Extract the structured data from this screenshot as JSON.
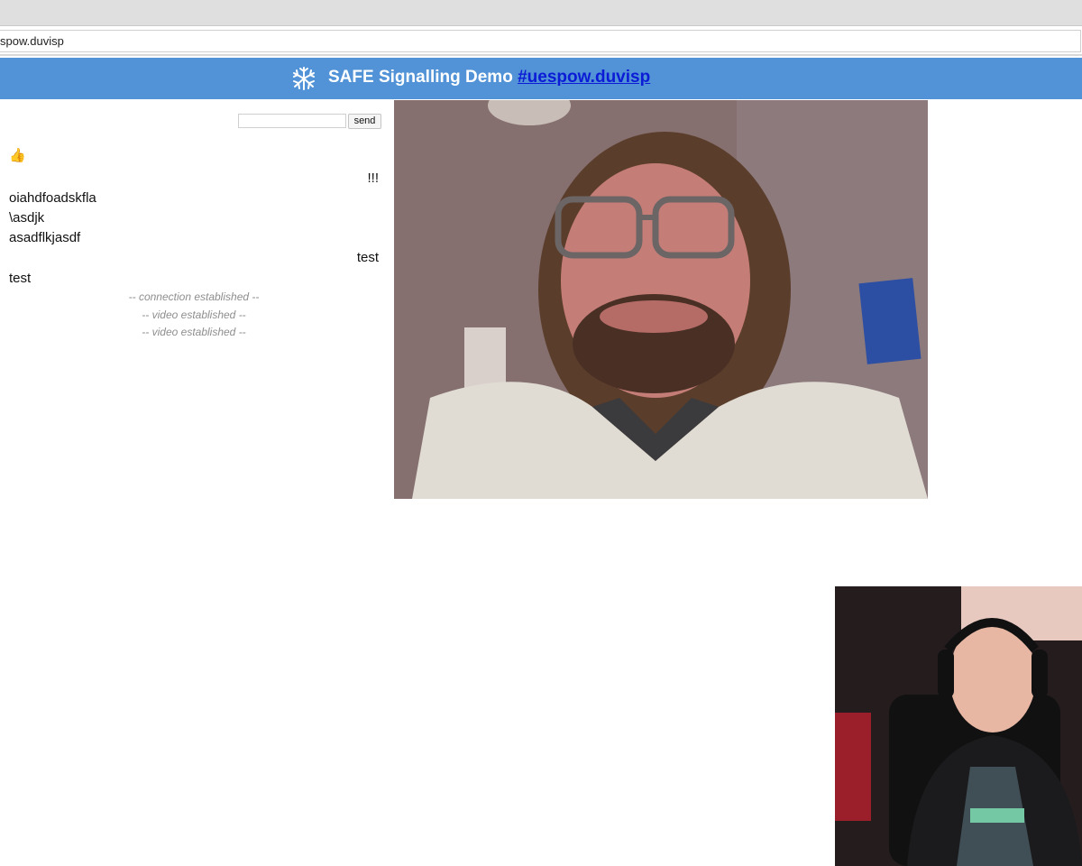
{
  "browser": {
    "address": "spow.duvisp"
  },
  "header": {
    "logo_icon": "safe-network-icon",
    "title": "SAFE Signalling Demo",
    "room_link": "#uespow.duvisp",
    "background": "#5193d6"
  },
  "chat": {
    "input_value": "",
    "send_label": "send",
    "reaction_emoji": "👍",
    "messages": [
      {
        "text": "!!!",
        "side": "right"
      },
      {
        "text": "oiahdfoadskfla",
        "side": "left"
      },
      {
        "text": "\\asdjk",
        "side": "left"
      },
      {
        "text": "asadflkjasdf",
        "side": "left"
      },
      {
        "text": "test",
        "side": "right"
      },
      {
        "text": "test",
        "side": "left"
      }
    ],
    "status": [
      "-- connection established --",
      "-- video established --",
      "-- video established --"
    ]
  },
  "videos": {
    "remote": "remote-video-feed",
    "local": "local-video-feed"
  }
}
